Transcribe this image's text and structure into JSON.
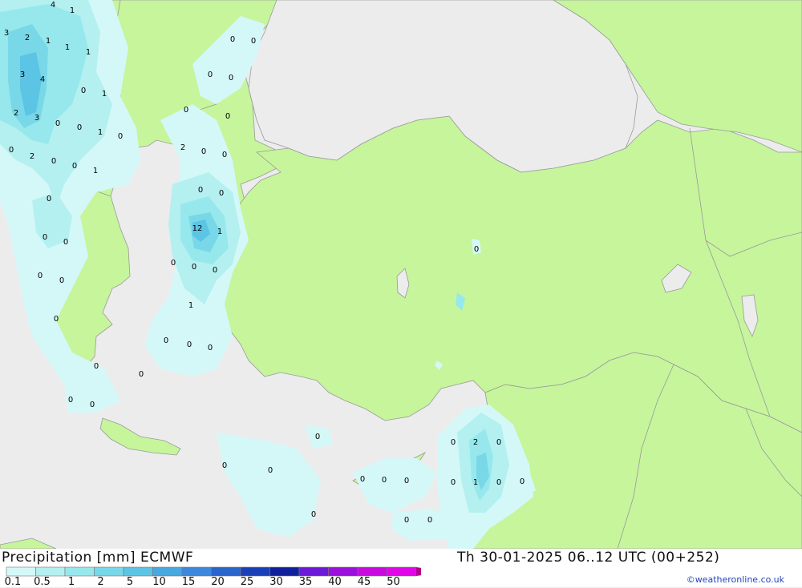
{
  "footer": {
    "title_left": "Precipitation [mm] ECMWF",
    "title_right": "Th 30-01-2025 06..12 UTC (00+252)",
    "credit": "©weatheronline.co.uk"
  },
  "legend": {
    "ticks": [
      "0.1",
      "0.5",
      "1",
      "2",
      "5",
      "10",
      "15",
      "20",
      "25",
      "30",
      "35",
      "40",
      "45",
      "50"
    ],
    "colors": [
      "#d4f8f8",
      "#b4f0f0",
      "#96e8ec",
      "#78d8e8",
      "#5cc4e4",
      "#48a8e0",
      "#3c88dc",
      "#2a64cc",
      "#1a40b8",
      "#10209c",
      "#6a1ad8",
      "#9a10dc",
      "#c80ae0",
      "#e006e8",
      "#b40090"
    ]
  },
  "colors": {
    "sea": "#ececec",
    "land": "#c6f59c",
    "border": "#9a9a9a"
  },
  "map_labels": [
    {
      "t": "4"
    },
    {
      "t": "1"
    },
    {
      "t": "3"
    },
    {
      "t": "2"
    },
    {
      "t": "1"
    },
    {
      "t": "1"
    },
    {
      "t": "1"
    },
    {
      "t": "0"
    },
    {
      "t": "0"
    },
    {
      "t": "3"
    },
    {
      "t": "4"
    },
    {
      "t": "0"
    },
    {
      "t": "0"
    },
    {
      "t": "0"
    },
    {
      "t": "1"
    },
    {
      "t": "0"
    },
    {
      "t": "2"
    },
    {
      "t": "3"
    },
    {
      "t": "0"
    },
    {
      "t": "0"
    },
    {
      "t": "1"
    },
    {
      "t": "0"
    },
    {
      "t": "0"
    },
    {
      "t": "0"
    },
    {
      "t": "2"
    },
    {
      "t": "0"
    },
    {
      "t": "0"
    },
    {
      "t": "2"
    },
    {
      "t": "1"
    },
    {
      "t": "0"
    },
    {
      "t": "0"
    },
    {
      "t": "0"
    },
    {
      "t": "0"
    },
    {
      "t": "0"
    },
    {
      "t": "12"
    },
    {
      "t": "1"
    },
    {
      "t": "0"
    },
    {
      "t": "0"
    },
    {
      "t": "0"
    },
    {
      "t": "0"
    },
    {
      "t": "0"
    },
    {
      "t": "0"
    },
    {
      "t": "0"
    },
    {
      "t": "1"
    },
    {
      "t": "0"
    },
    {
      "t": "0"
    },
    {
      "t": "0"
    },
    {
      "t": "0"
    },
    {
      "t": "0"
    },
    {
      "t": "0"
    },
    {
      "t": "0"
    },
    {
      "t": "0"
    },
    {
      "t": "0"
    },
    {
      "t": "0"
    },
    {
      "t": "0"
    },
    {
      "t": "0"
    },
    {
      "t": "0"
    },
    {
      "t": "0"
    },
    {
      "t": "0"
    },
    {
      "t": "0"
    },
    {
      "t": "2"
    },
    {
      "t": "0"
    },
    {
      "t": "0"
    },
    {
      "t": "1"
    },
    {
      "t": "0"
    },
    {
      "t": "0"
    },
    {
      "t": "0"
    },
    {
      "t": "0"
    },
    {
      "t": "0"
    }
  ]
}
